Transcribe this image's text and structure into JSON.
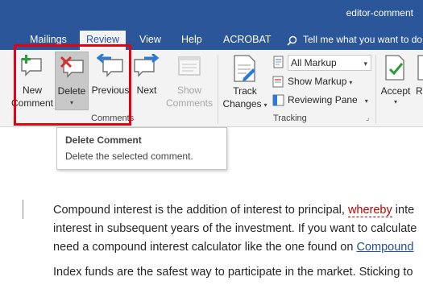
{
  "window": {
    "title": "editor-comment"
  },
  "tabs": [
    {
      "label": "Mailings",
      "active": false
    },
    {
      "label": "Review",
      "active": true
    },
    {
      "label": "View",
      "active": false
    },
    {
      "label": "Help",
      "active": false
    },
    {
      "label": "ACROBAT",
      "active": false
    }
  ],
  "tell_me": {
    "text": "Tell me what you want to do"
  },
  "ribbon": {
    "comments": {
      "new_comment": {
        "line1": "New",
        "line2": "Comment"
      },
      "delete": {
        "label": "Delete",
        "pressed": true
      },
      "previous": {
        "label": "Previous"
      },
      "next": {
        "label": "Next"
      },
      "show_comments": {
        "line1": "Show",
        "line2": "Comments",
        "disabled": true
      },
      "group_label": "Comments"
    },
    "tracking": {
      "track_changes": {
        "line1": "Track",
        "line2": "Changes"
      },
      "markup_select": {
        "value": "All Markup"
      },
      "show_markup": {
        "label": "Show Markup"
      },
      "reviewing_pane": {
        "label": "Reviewing Pane"
      },
      "group_label": "Tracking"
    },
    "changes": {
      "accept": {
        "label": "Accept"
      },
      "reject": {
        "label": "Reje"
      }
    }
  },
  "tooltip": {
    "title": "Delete Comment",
    "description": "Delete the selected comment."
  },
  "document": {
    "para1": {
      "line1_before": "Compound interest is the addition of interest to principal, ",
      "line1_flagged": "whereby",
      "line1_after": " inte",
      "line2": "interest in subsequent years of the investment. If you want to calculate",
      "line3_before": "need a compound interest calculator like the one found on ",
      "line3_link": "Compound"
    },
    "para2": "Index funds are the safest way to participate in the market. Sticking to"
  },
  "colors": {
    "title_bar": "#2b579a",
    "ribbon": "#f3f3f3",
    "highlight_box": "#e60012",
    "link": "#1f4e9a",
    "flagged_text": "#c00000"
  },
  "icons": [
    "new-comment-icon",
    "delete-comment-icon",
    "previous-comment-icon",
    "next-comment-icon",
    "show-comments-icon",
    "track-changes-icon",
    "markup-icon",
    "reviewing-pane-icon",
    "accept-icon",
    "reject-icon",
    "search-icon"
  ]
}
